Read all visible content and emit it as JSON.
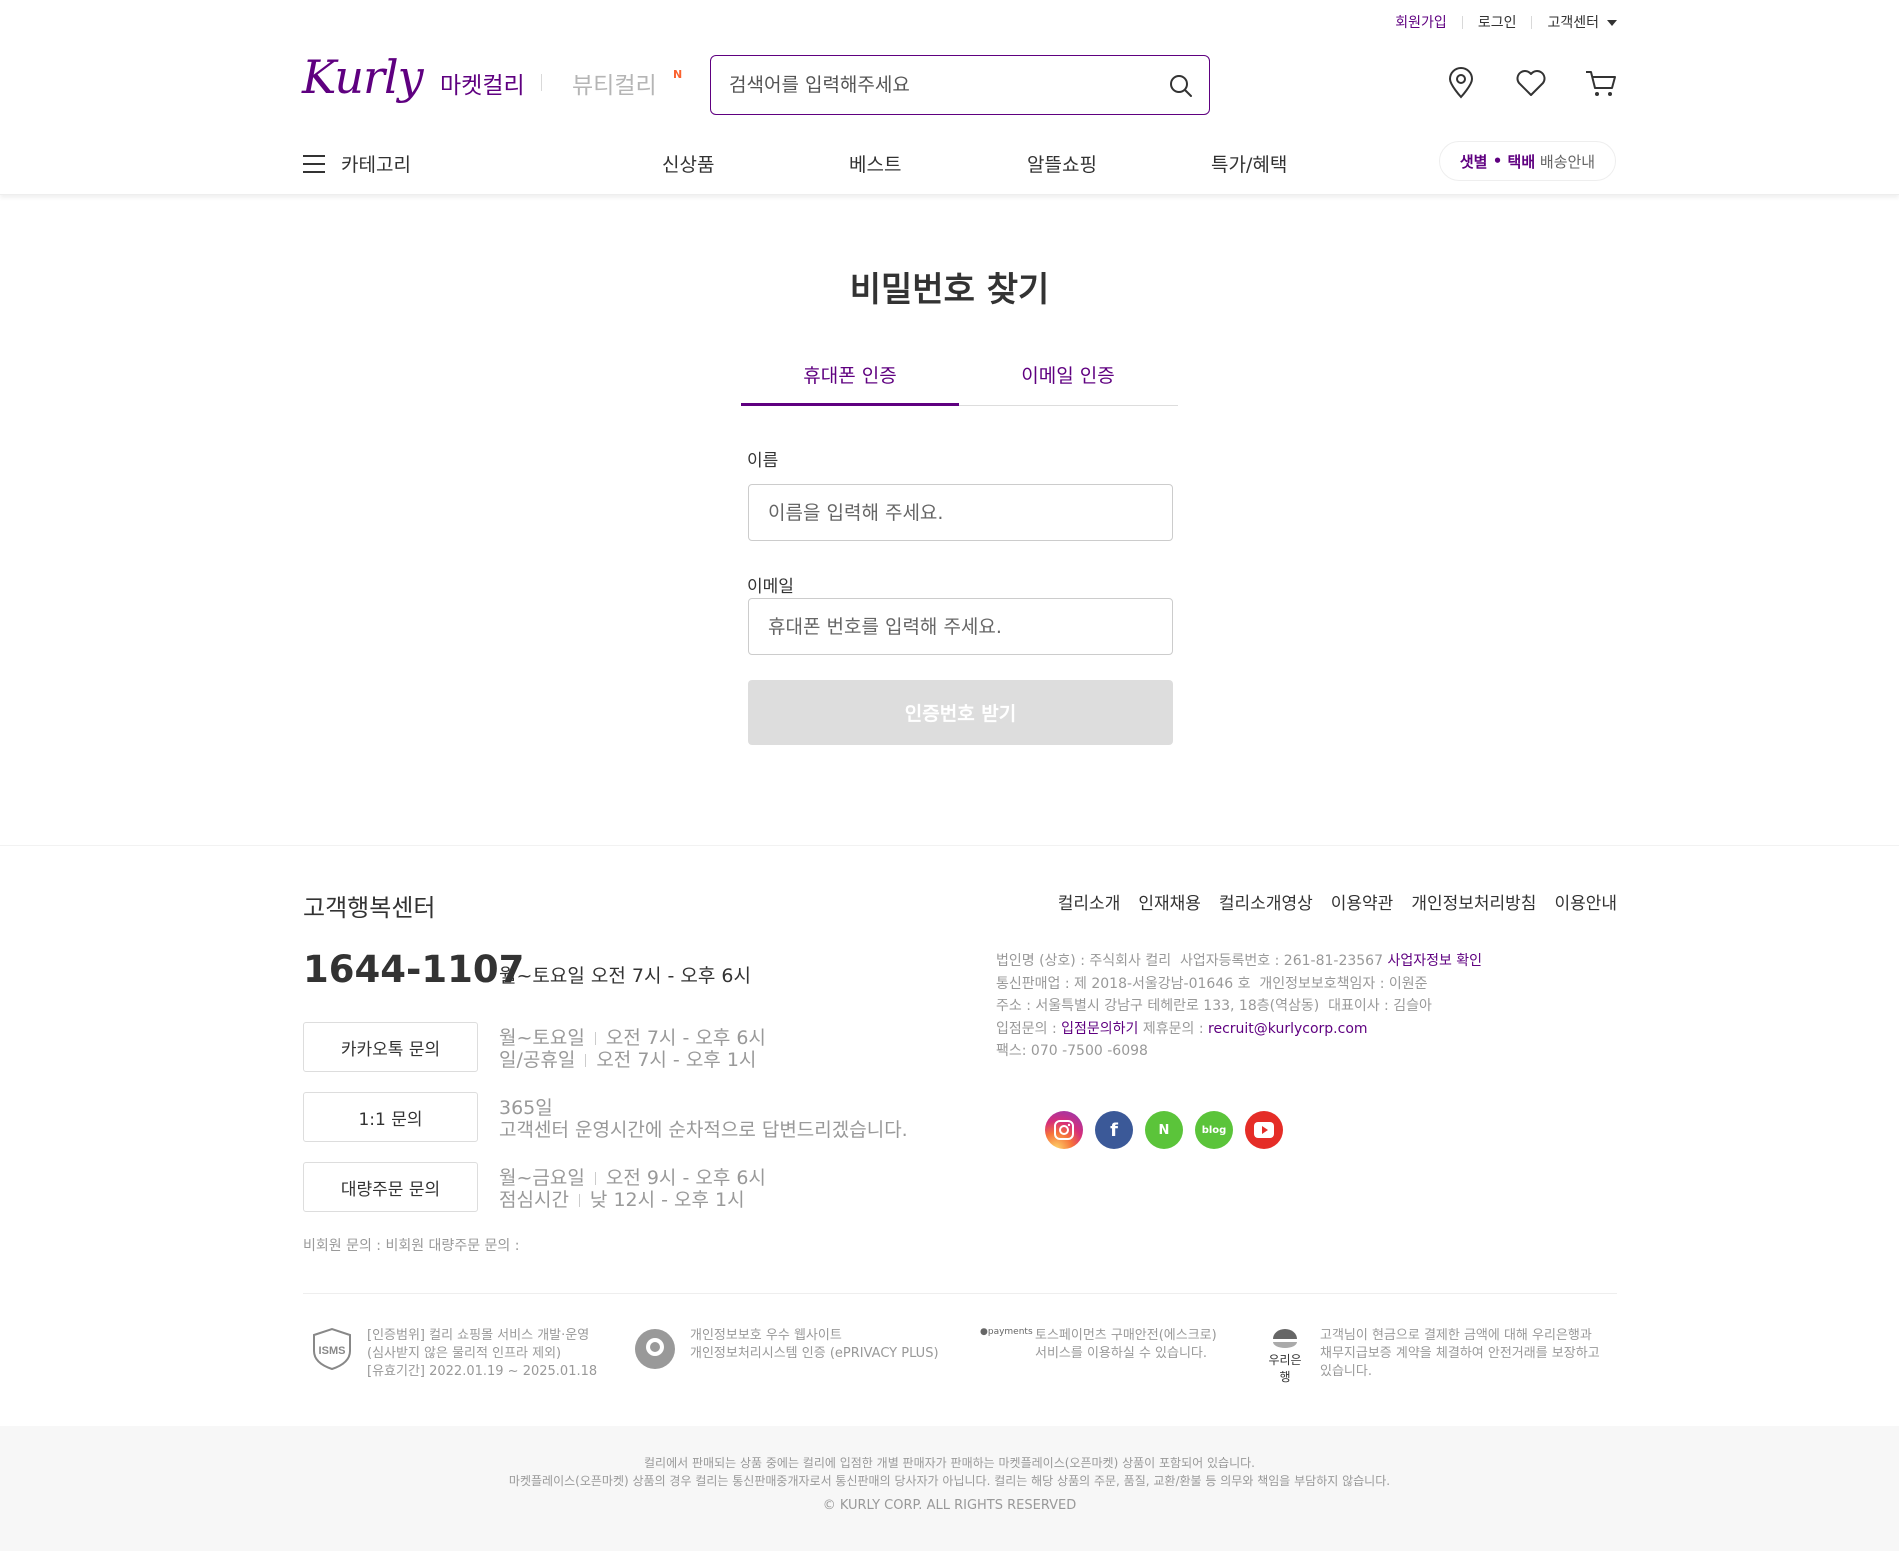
{
  "header": {
    "util": {
      "signup": "회원가입",
      "login": "로그인",
      "support": "고객센터"
    },
    "logo": "Kurly",
    "market": "마켓컬리",
    "beauty": "뷰티컬리",
    "beauty_badge": "N",
    "search": {
      "placeholder": "검색어를 입력해주세요"
    }
  },
  "nav": {
    "category": "카테고리",
    "items": [
      "신상품",
      "베스트",
      "알뜰쇼핑",
      "특가/혜택"
    ],
    "delivery": {
      "dawn": "샛별",
      "dot": " • ",
      "parcel": "택배",
      "guide": " 배송안내"
    }
  },
  "main": {
    "title": "비밀번호 찾기",
    "tabs": [
      {
        "label": "휴대폰 인증",
        "active": true
      },
      {
        "label": "이메일 인증",
        "active": false
      }
    ],
    "name_label": "이름",
    "name_placeholder": "이름을 입력해 주세요.",
    "email_label": "이메일",
    "email_placeholder": "휴대폰 번호를 입력해 주세요.",
    "submit_label": "인증번호 받기"
  },
  "footer": {
    "cs_title": "고객행복센터",
    "phone": "1644-1107",
    "phone_hours": "월~토요일 오전 7시 - 오후 6시",
    "kakao": {
      "label": "카카오톡 문의",
      "line1a": "월~토요일",
      "line1b": "오전 7시 - 오후 6시",
      "line2a": "일/공휴일",
      "line2b": "오전 7시 - 오후 1시"
    },
    "one2one": {
      "label": "1:1 문의",
      "line1": "365일",
      "line2": "고객센터 운영시간에 순차적으로 답변드리겠습니다."
    },
    "bulk": {
      "label": "대량주문 문의",
      "line1a": "월~금요일",
      "line1b": "오전 9시 - 오후 6시",
      "line2a": "점심시간",
      "line2b": "낮 12시 - 오후 1시"
    },
    "nonmember": "비회원 문의 : 비회원 대량주문 문의 :",
    "links": [
      "컬리소개",
      "인재채용",
      "컬리소개영상",
      "이용약관",
      "개인정보처리방침",
      "이용안내"
    ],
    "corp": {
      "line1": "법인명 (상호) : 주식회사 컬리  사업자등록번호 : 261-81-23567",
      "line1_link": "사업자정보 확인",
      "line2": "통신판매업 : 제 2018-서울강남-01646 호  개인정보보호책임자 : 이원준",
      "line3": "주소 : 서울특별시 강남구 테헤란로 133, 18층(역삼동)  대표이사 : 김슬아",
      "line4a": "입점문의 :",
      "line4_link1": "입점문의하기",
      "line4b": "제휴문의 :",
      "line4_link2": "recruit@kurlycorp.com",
      "line5": "팩스: 070 -7500 -6098"
    },
    "social": [
      "instagram-icon",
      "facebook-icon",
      "naver-post-icon",
      "blog-icon",
      "youtube-icon"
    ],
    "certs": {
      "isms_logo": "ISMS",
      "isms": [
        "[인증범위] 컬리 쇼핑몰 서비스 개발·운영",
        "(심사받지 않은 물리적 인프라 제외)",
        "[유효기간] 2022.01.19 ~ 2025.01.18"
      ],
      "privacy": [
        "개인정보보호 우수 웹사이트",
        "개인정보처리시스템 인증 (ePRIVACY PLUS)"
      ],
      "toss_logo": "payments",
      "toss": [
        "토스페이먼츠 구매안전(에스크로)",
        "서비스를 이용하실 수 있습니다."
      ],
      "woori_logo": "우리은행",
      "woori": [
        "고객님이 현금으로 결제한 금액에 대해 우리은행과",
        "채무지급보증 계약을 체결하여 안전거래를 보장하고",
        "있습니다."
      ]
    },
    "bottom": {
      "l1": "컬리에서 판매되는 상품 중에는 컬리에 입점한 개별 판매자가 판매하는 마켓플레이스(오픈마켓) 상품이 포함되어 있습니다.",
      "l2": "마켓플레이스(오픈마켓) 상품의 경우 컬리는 통신판매중개자로서 통신판매의 당사자가 아닙니다. 컬리는 해당 상품의 주문, 품질, 교환/환불 등 의무와 책임을 부담하지 않습니다.",
      "l3": "© KURLY CORP. ALL RIGHTS RESERVED"
    }
  },
  "colors": {
    "brand": "#5f0080",
    "beauty_badge": "#fa622f",
    "disabled": "#dddddd"
  }
}
